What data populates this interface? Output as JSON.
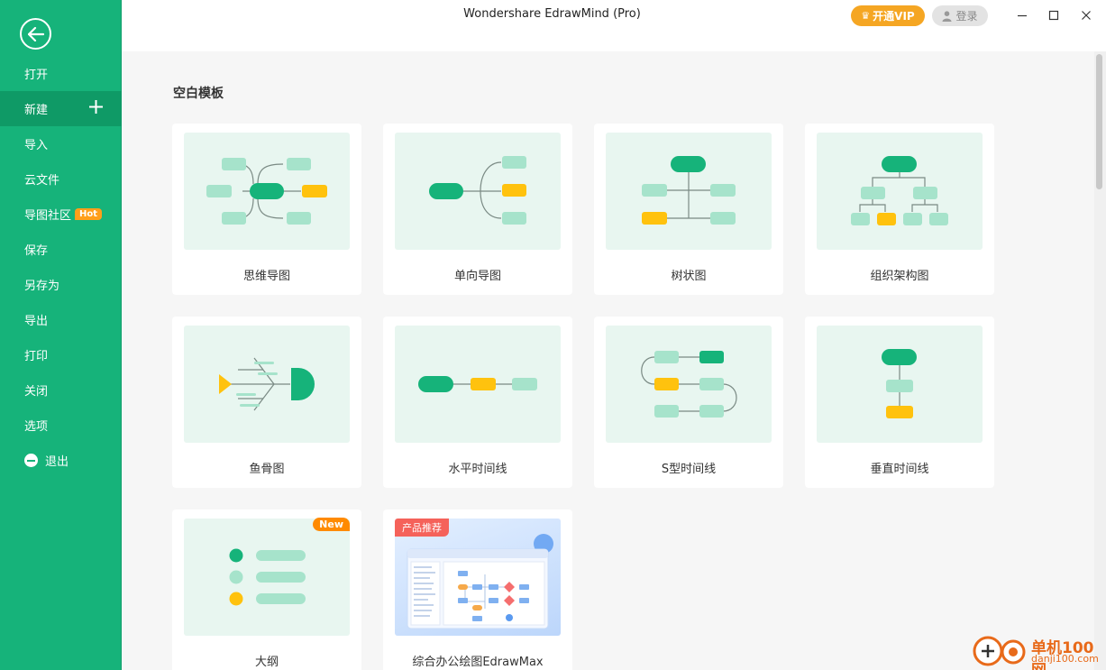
{
  "window": {
    "title": "Wondershare EdrawMind (Pro)",
    "vip_label": "开通VIP",
    "login_label": "登录"
  },
  "sidebar": {
    "items": [
      {
        "label": "打开"
      },
      {
        "label": "新建"
      },
      {
        "label": "导入"
      },
      {
        "label": "云文件"
      },
      {
        "label": "导图社区",
        "badge": "Hot"
      },
      {
        "label": "保存"
      },
      {
        "label": "另存为"
      },
      {
        "label": "导出"
      },
      {
        "label": "打印"
      },
      {
        "label": "关闭"
      },
      {
        "label": "选项"
      },
      {
        "label": "退出"
      }
    ]
  },
  "main": {
    "section_title": "空白模板",
    "templates": [
      {
        "label": "思维导图"
      },
      {
        "label": "单向导图"
      },
      {
        "label": "树状图"
      },
      {
        "label": "组织架构图"
      },
      {
        "label": "鱼骨图"
      },
      {
        "label": "水平时间线"
      },
      {
        "label": "S型时间线"
      },
      {
        "label": "垂直时间线"
      },
      {
        "label": "大纲",
        "badge": "New"
      },
      {
        "label": "综合办公绘图EdrawMax",
        "badge": "产品推荐"
      }
    ]
  },
  "watermark": {
    "title": "单机100网",
    "url": "danji100.com"
  },
  "colors": {
    "primary": "#16b37a",
    "light_node": "#a6e3cb",
    "accent": "#ffc20e",
    "vip": "#f5a623"
  }
}
